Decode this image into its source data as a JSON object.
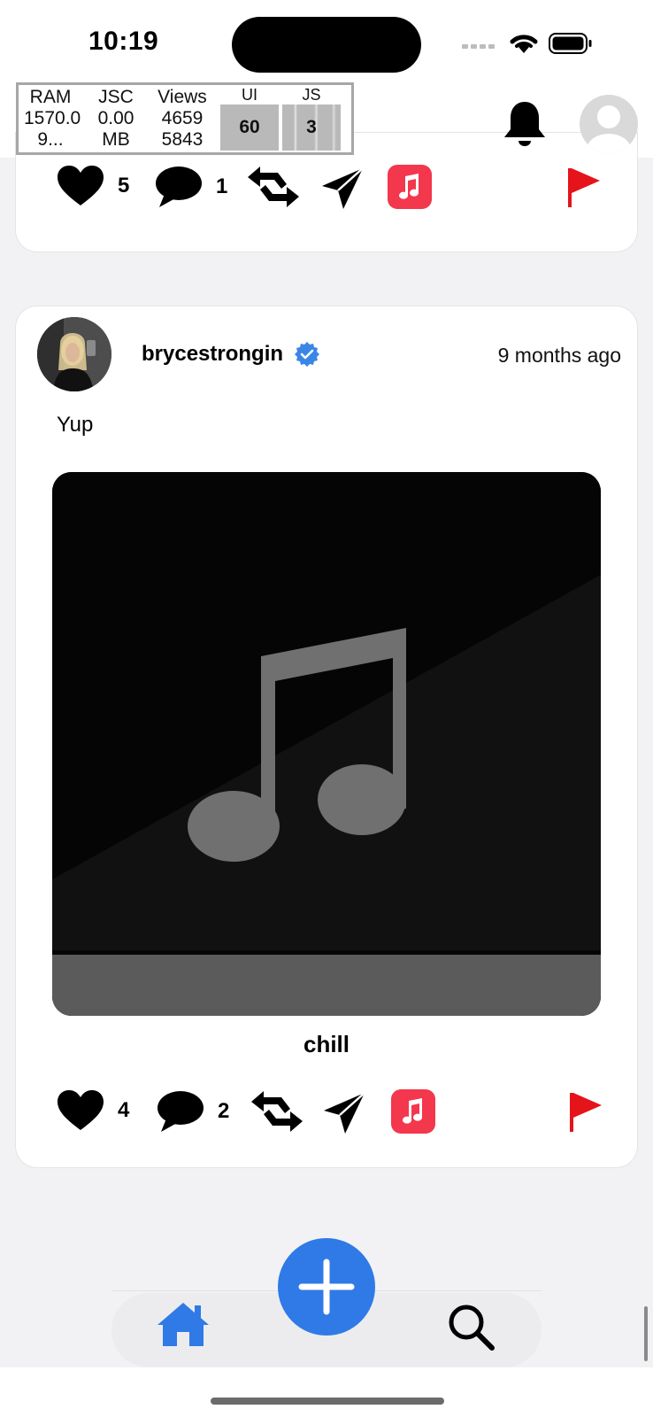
{
  "status": {
    "time": "10:19"
  },
  "perf_monitor": {
    "ram": {
      "label": "RAM",
      "value": "1570.0",
      "extra": "9..."
    },
    "jsc": {
      "label": "JSC",
      "value": "0.00",
      "unit": "MB"
    },
    "views": {
      "label": "Views",
      "value1": "4659",
      "value2": "5843"
    },
    "ui": {
      "label": "UI",
      "fps": "60"
    },
    "js": {
      "label": "JS",
      "fps": "3"
    }
  },
  "header": {
    "notifications_icon": "bell-icon",
    "profile_icon": "avatar-placeholder-icon"
  },
  "previous_post": {
    "likes": "5",
    "comments": "1",
    "icons": [
      "heart-icon",
      "comment-icon",
      "repost-icon",
      "send-icon",
      "apple-music-icon",
      "flag-icon"
    ]
  },
  "post": {
    "username": "brycestrongin",
    "verified": true,
    "time_ago": "9 months ago",
    "text": "Yup",
    "track_title": "chill",
    "likes": "4",
    "comments": "2"
  },
  "nav": {
    "home_icon": "home-icon",
    "create_icon": "plus-icon",
    "search_icon": "search-icon"
  },
  "colors": {
    "accent": "#2f7ae6",
    "flag": "#e5131a",
    "music_app": "#f3374d",
    "verified": "#3a86e6"
  }
}
